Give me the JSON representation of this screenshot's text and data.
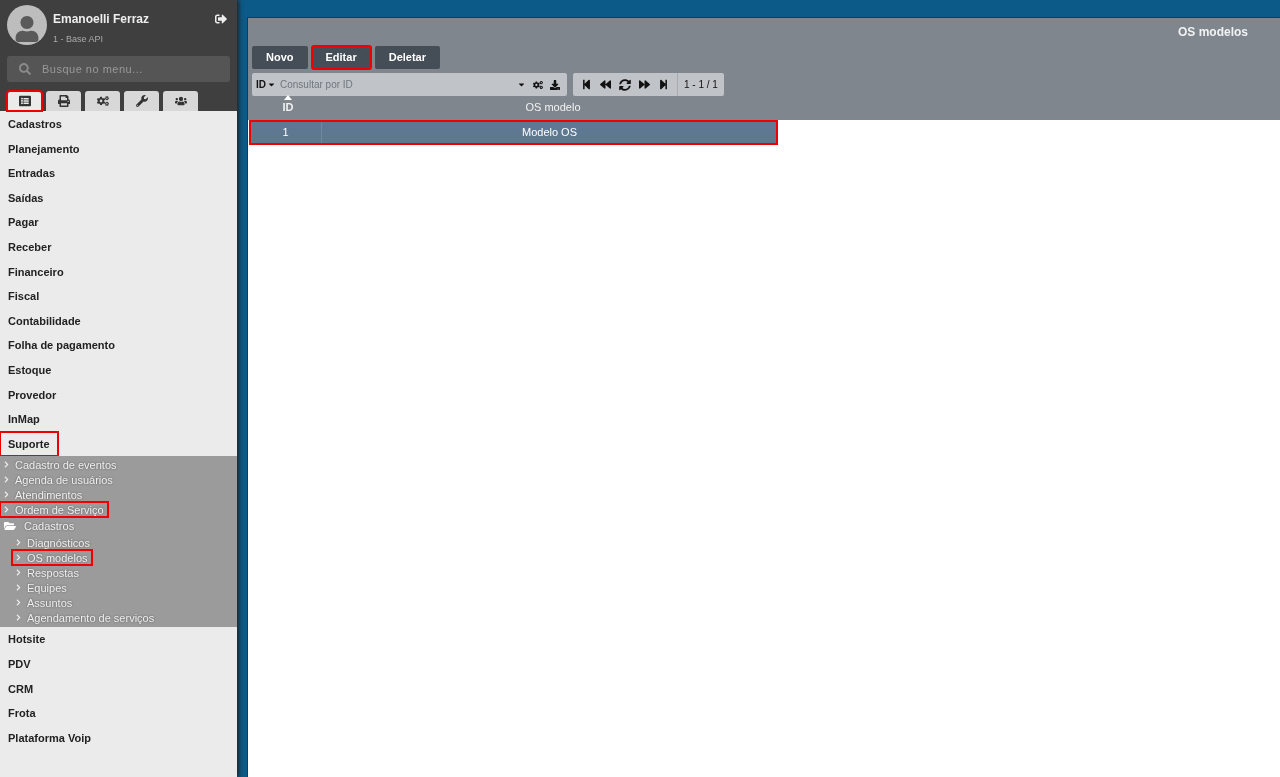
{
  "user": {
    "name": "Emanoelli Ferraz",
    "subtitle": "1 - Base API"
  },
  "search": {
    "placeholder": "Busque no menu..."
  },
  "sidebar_tabs": [
    {
      "selected": true,
      "highlighted": true
    },
    {
      "selected": false,
      "highlighted": false
    },
    {
      "selected": false,
      "highlighted": false
    },
    {
      "selected": false,
      "highlighted": false
    },
    {
      "selected": false,
      "highlighted": false
    }
  ],
  "menu": [
    {
      "label": "Cadastros",
      "highlighted": false
    },
    {
      "label": "Planejamento",
      "highlighted": false
    },
    {
      "label": "Entradas",
      "highlighted": false
    },
    {
      "label": "Saídas",
      "highlighted": false
    },
    {
      "label": "Pagar",
      "highlighted": false
    },
    {
      "label": "Receber",
      "highlighted": false
    },
    {
      "label": "Financeiro",
      "highlighted": false
    },
    {
      "label": "Fiscal",
      "highlighted": false
    },
    {
      "label": "Contabilidade",
      "highlighted": false
    },
    {
      "label": "Folha de pagamento",
      "highlighted": false
    },
    {
      "label": "Estoque",
      "highlighted": false
    },
    {
      "label": "Provedor",
      "highlighted": false
    },
    {
      "label": "InMap",
      "highlighted": false
    },
    {
      "label": "Suporte",
      "highlighted": true,
      "children": [
        {
          "kind": "link",
          "label": "Cadastro de eventos",
          "highlighted": false
        },
        {
          "kind": "link",
          "label": "Agenda de usuários",
          "highlighted": false
        },
        {
          "kind": "link",
          "label": "Atendimentos",
          "highlighted": false
        },
        {
          "kind": "link",
          "label": "Ordem de Serviço",
          "highlighted": true
        },
        {
          "kind": "folder",
          "label": "Cadastros",
          "highlighted": false,
          "children": [
            {
              "kind": "link",
              "label": "Diagnósticos",
              "highlighted": false
            },
            {
              "kind": "link",
              "label": "OS modelos",
              "highlighted": true
            },
            {
              "kind": "link",
              "label": "Respostas",
              "highlighted": false
            },
            {
              "kind": "link",
              "label": "Equipes",
              "highlighted": false
            },
            {
              "kind": "link",
              "label": "Assuntos",
              "highlighted": false
            },
            {
              "kind": "link",
              "label": "Agendamento de serviços",
              "highlighted": false
            }
          ]
        }
      ]
    },
    {
      "label": "Hotsite",
      "highlighted": false
    },
    {
      "label": "PDV",
      "highlighted": false
    },
    {
      "label": "CRM",
      "highlighted": false
    },
    {
      "label": "Frota",
      "highlighted": false
    },
    {
      "label": "Plataforma Voip",
      "highlighted": false
    }
  ],
  "window": {
    "title": "OS modelos"
  },
  "toolbar": [
    {
      "label": "Novo",
      "highlighted": false
    },
    {
      "label": "Editar",
      "highlighted": true
    },
    {
      "label": "Deletar",
      "highlighted": false
    }
  ],
  "query": {
    "field": "ID",
    "placeholder": "Consultar por ID"
  },
  "pager": {
    "range": "1 - 1 / 1"
  },
  "table": {
    "columns": [
      {
        "label": "ID",
        "sorted": true
      },
      {
        "label": "OS modelo",
        "sorted": false
      }
    ],
    "rows": [
      {
        "cells": [
          "1",
          "Modelo OS"
        ],
        "selected": true,
        "highlighted": true
      }
    ]
  }
}
